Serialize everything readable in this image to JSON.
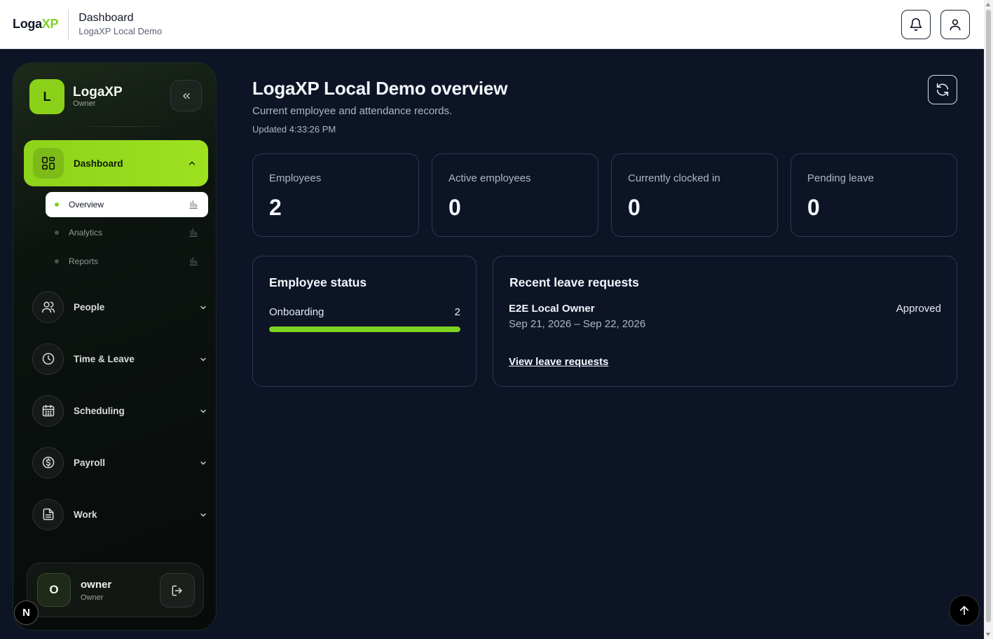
{
  "header": {
    "brand_main": "Loga",
    "brand_accent": "XP",
    "page_title": "Dashboard",
    "org_name": "LogaXP Local Demo",
    "notifications_icon": "bell-icon",
    "profile_icon": "user-icon"
  },
  "sidebar": {
    "avatar_letter": "L",
    "org_name": "LogaXP",
    "role": "Owner",
    "collapse_icon": "double-chevron-left-icon",
    "active_section": {
      "label": "Dashboard",
      "icon": "grid-icon",
      "expanded": true,
      "sub_items": [
        {
          "label": "Overview",
          "active": true
        },
        {
          "label": "Analytics",
          "active": false
        },
        {
          "label": "Reports",
          "active": false
        }
      ]
    },
    "items": [
      {
        "label": "People",
        "icon": "users-icon"
      },
      {
        "label": "Time & Leave",
        "icon": "clock-icon"
      },
      {
        "label": "Scheduling",
        "icon": "calendar-icon"
      },
      {
        "label": "Payroll",
        "icon": "dollar-icon"
      },
      {
        "label": "Work",
        "icon": "document-icon"
      }
    ],
    "user": {
      "avatar_letter": "O",
      "name": "owner",
      "role": "Owner",
      "logout_icon": "logout-icon"
    }
  },
  "badge": {
    "letter": "N"
  },
  "main": {
    "title": "LogaXP Local Demo overview",
    "subtitle": "Current employee and attendance records.",
    "updated": "Updated 4:33:26 PM",
    "stats": [
      {
        "label": "Employees",
        "value": "2"
      },
      {
        "label": "Active employees",
        "value": "0"
      },
      {
        "label": "Currently clocked in",
        "value": "0"
      },
      {
        "label": "Pending leave",
        "value": "0"
      }
    ],
    "employee_status": {
      "title": "Employee status",
      "rows": [
        {
          "label": "Onboarding",
          "count": "2",
          "fraction": 1.0
        }
      ]
    },
    "leave": {
      "title": "Recent leave requests",
      "requests": [
        {
          "name": "E2E Local Owner",
          "dates": "Sep 21, 2026 – Sep 22, 2026",
          "status": "Approved"
        }
      ],
      "link": "View leave requests"
    }
  },
  "colors": {
    "accent": "#8ed31b",
    "background": "#0d1426"
  }
}
